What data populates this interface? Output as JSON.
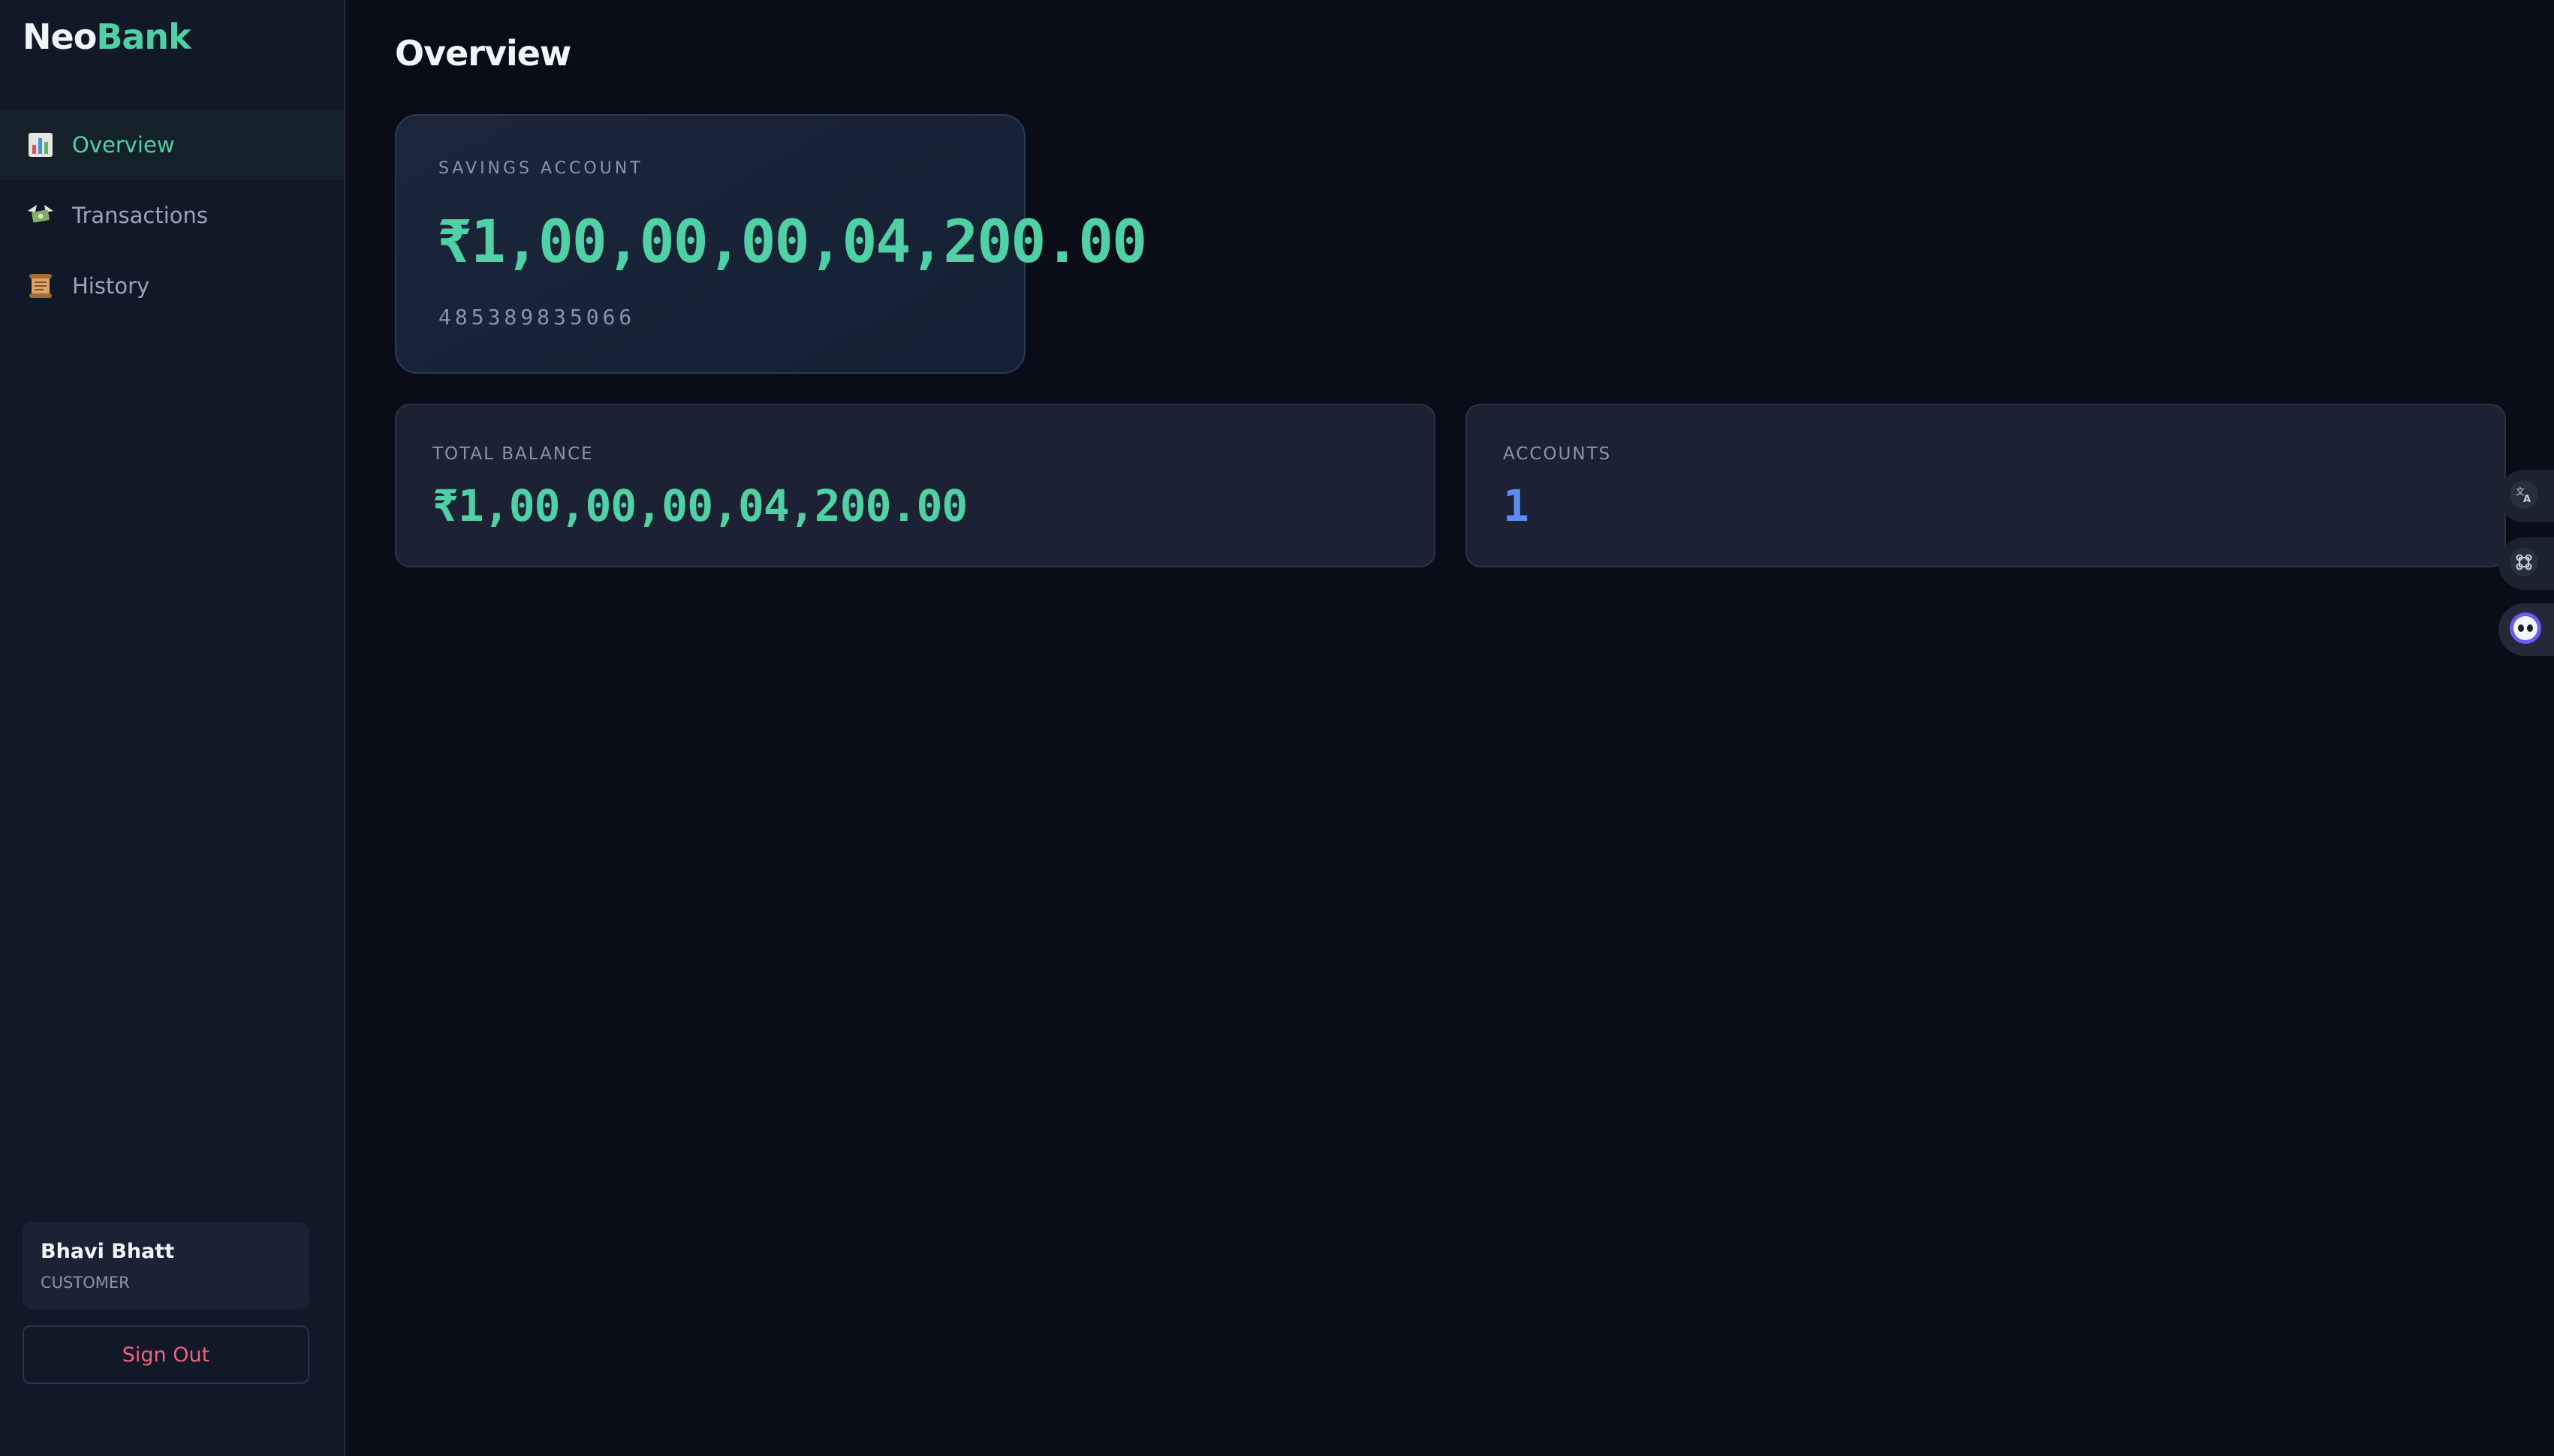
{
  "brand": {
    "part1": "Neo",
    "part2": "Bank"
  },
  "sidebar": {
    "items": [
      {
        "label": "Overview",
        "icon": "bar-chart-icon",
        "active": true
      },
      {
        "label": "Transactions",
        "icon": "money-wings-icon",
        "active": false
      },
      {
        "label": "History",
        "icon": "scroll-icon",
        "active": false
      }
    ],
    "user": {
      "name": "Bhavi Bhatt",
      "role": "CUSTOMER"
    },
    "signout_label": "Sign Out"
  },
  "main": {
    "title": "Overview",
    "account_card": {
      "type": "SAVINGS ACCOUNT",
      "balance": "₹1,00,00,00,04,200.00",
      "number": "485389835066"
    },
    "stats": {
      "total_balance_label": "TOTAL BALANCE",
      "total_balance_value": "₹1,00,00,00,04,200.00",
      "accounts_label": "ACCOUNTS",
      "accounts_value": "1"
    }
  },
  "widgets": [
    {
      "icon": "translate-icon"
    },
    {
      "icon": "command-icon"
    },
    {
      "icon": "assistant-bot-icon"
    }
  ],
  "colors": {
    "accent": "#4fd1a5",
    "accounts_value": "#5b8def",
    "signout": "#f0627a",
    "background": "#0a0d18",
    "sidebar": "#111827"
  }
}
